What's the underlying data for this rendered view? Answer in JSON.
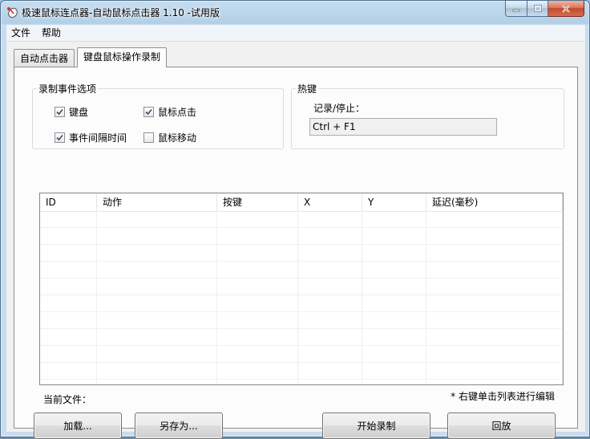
{
  "window": {
    "title": "极速鼠标连点器-自动鼠标点击器 1.10  -试用版"
  },
  "menu": {
    "file": "文件",
    "help": "帮助"
  },
  "tabs": [
    {
      "label": "自动点击器",
      "active": false
    },
    {
      "label": "键盘鼠标操作录制",
      "active": true
    }
  ],
  "record_options": {
    "title": "录制事件选项",
    "items": [
      {
        "label": "键盘",
        "checked": true
      },
      {
        "label": "鼠标点击",
        "checked": true
      },
      {
        "label": "事件间隔时间",
        "checked": true
      },
      {
        "label": "鼠标移动",
        "checked": false
      }
    ]
  },
  "hotkey": {
    "title": "热键",
    "label": "记录/停止：",
    "value": "Ctrl + F1"
  },
  "table": {
    "columns": [
      "ID",
      "动作",
      "按键",
      "X",
      "Y",
      "延迟(毫秒)"
    ],
    "rows": []
  },
  "status": {
    "current_file": "当前文件：",
    "hint": "* 右键单击列表进行编辑"
  },
  "buttons": {
    "load": "加载...",
    "save_as": "另存为...",
    "start_record": "开始录制",
    "playback": "回放"
  },
  "colors": {
    "title_bar": "#b3cfe6",
    "close_button": "#c24b2c",
    "panel_bg": "#fcfcfc"
  }
}
